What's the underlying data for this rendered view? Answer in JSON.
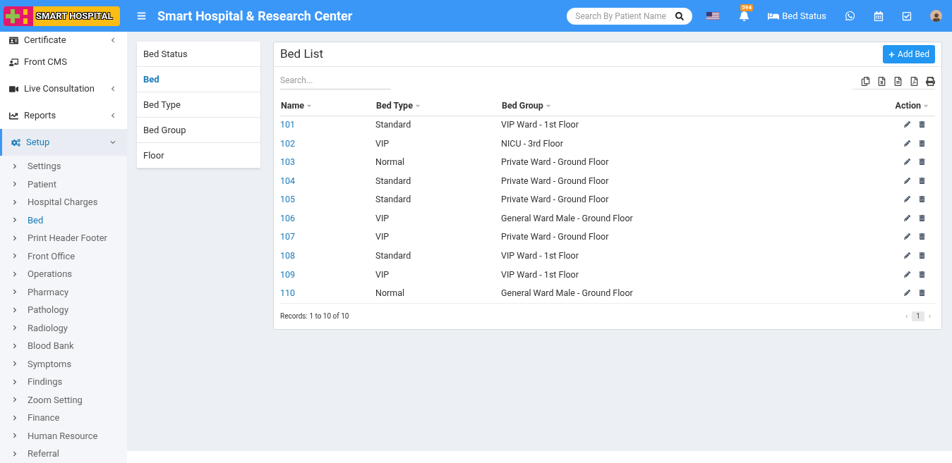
{
  "header": {
    "logo": "SMART HOSPITAL",
    "title": "Smart Hospital & Research Center",
    "search": {
      "placeholder": "Search By Patient Name"
    },
    "notifications": "594",
    "bed_status": "Bed Status"
  },
  "sidebar": {
    "items": [
      {
        "label": "Certificate",
        "expanded": false,
        "selected": false
      },
      {
        "label": "Front CMS",
        "selected": false
      },
      {
        "label": "Live Consultation",
        "expanded": false,
        "selected": false
      },
      {
        "label": "Reports",
        "expanded": false,
        "selected": false
      },
      {
        "label": "Setup",
        "expanded": true,
        "selected": true,
        "children": [
          {
            "label": "Settings",
            "selected": false
          },
          {
            "label": "Patient",
            "selected": false
          },
          {
            "label": "Hospital Charges",
            "selected": false
          },
          {
            "label": "Bed",
            "selected": true
          },
          {
            "label": "Print Header Footer",
            "selected": false
          },
          {
            "label": "Front Office",
            "selected": false
          },
          {
            "label": "Operations",
            "selected": false
          },
          {
            "label": "Pharmacy",
            "selected": false
          },
          {
            "label": "Pathology",
            "selected": false
          },
          {
            "label": "Radiology",
            "selected": false
          },
          {
            "label": "Blood Bank",
            "selected": false
          },
          {
            "label": "Symptoms",
            "selected": false
          },
          {
            "label": "Findings",
            "selected": false
          },
          {
            "label": "Zoom Setting",
            "selected": false
          },
          {
            "label": "Finance",
            "selected": false
          },
          {
            "label": "Human Resource",
            "selected": false
          },
          {
            "label": "Referral",
            "selected": false
          }
        ]
      }
    ]
  },
  "submenu": [
    {
      "label": "Bed Status",
      "selected": false
    },
    {
      "label": "Bed",
      "selected": true
    },
    {
      "label": "Bed Type",
      "selected": false
    },
    {
      "label": "Bed Group",
      "selected": false
    },
    {
      "label": "Floor",
      "selected": false
    }
  ],
  "panel": {
    "title": "Bed List",
    "add_button": "Add Bed",
    "search": {
      "placeholder": "Search..."
    },
    "columns": [
      "Name",
      "Bed Type",
      "Bed Group",
      "Action"
    ],
    "rows": [
      [
        "101",
        "Standard",
        "VIP Ward - 1st Floor"
      ],
      [
        "102",
        "VIP",
        "NICU - 3rd Floor"
      ],
      [
        "103",
        "Normal",
        "Private Ward - Ground Floor"
      ],
      [
        "104",
        "Standard",
        "Private Ward - Ground Floor"
      ],
      [
        "105",
        "Standard",
        "Private Ward - Ground Floor"
      ],
      [
        "106",
        "VIP",
        "General Ward Male - Ground Floor"
      ],
      [
        "107",
        "VIP",
        "Private Ward - Ground Floor"
      ],
      [
        "108",
        "Standard",
        "VIP Ward - 1st Floor"
      ],
      [
        "109",
        "VIP",
        "VIP Ward - 1st Floor"
      ],
      [
        "110",
        "Normal",
        "General Ward Male - Ground Floor"
      ]
    ],
    "records": "Records: 1 to 10 of 10",
    "pages": [
      {
        "label": "1",
        "selected": true
      }
    ],
    "prev": "‹",
    "next": "›"
  }
}
